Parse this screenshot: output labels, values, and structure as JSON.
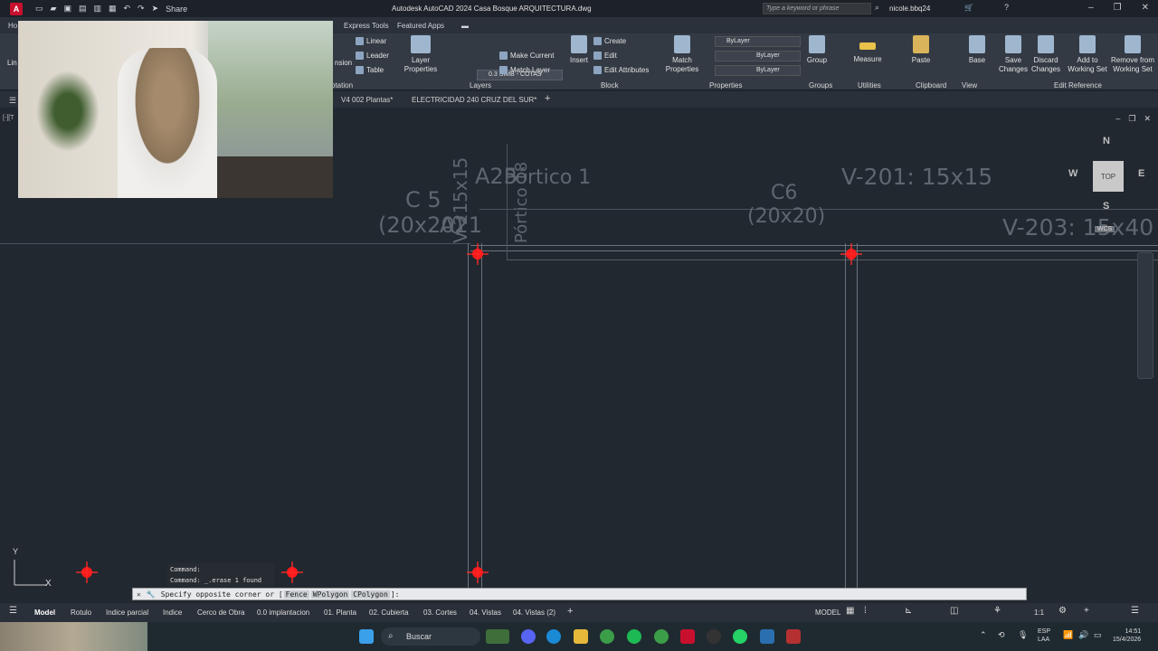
{
  "titlebar": {
    "app_letter": "A",
    "title": "Autodesk AutoCAD 2024    Casa Bosque ARQUITECTURA.dwg",
    "share": "Share",
    "search_placeholder": "Type a keyword or phrase",
    "user": "nicole.bbq24"
  },
  "ribbon_tabs": {
    "home_fragment": "Ho",
    "express_tools": "Express Tools",
    "featured_apps": "Featured Apps"
  },
  "ribbon": {
    "annotation": {
      "linear": "Linear",
      "leader": "Leader",
      "table": "Table",
      "dimension_fragment": "nsion",
      "panel": "otation",
      "line_fragment": "Lin"
    },
    "layers": {
      "layer_properties": "Layer Properties",
      "current_layer": "0.3 SIMB - COTAS",
      "make_current": "Make Current",
      "match_layer": "Match Layer",
      "panel": "Layers"
    },
    "block": {
      "insert": "Insert",
      "create": "Create",
      "edit": "Edit",
      "edit_attributes": "Edit Attributes",
      "panel": "Block"
    },
    "properties": {
      "match_properties": "Match Properties",
      "color": "ByLayer",
      "linetype": "ByLayer",
      "lineweight": "ByLayer",
      "panel": "Properties"
    },
    "groups": {
      "group": "Group",
      "panel": "Groups"
    },
    "utilities": {
      "measure": "Measure",
      "panel": "Utilities"
    },
    "clipboard": {
      "paste": "Paste",
      "panel": "Clipboard"
    },
    "view": {
      "base": "Base",
      "panel": "View"
    },
    "edit_reference": {
      "save": "Save Changes",
      "discard": "Discard Changes",
      "add": "Add to Working Set",
      "remove": "Remove from Working Set",
      "panel": "Edit Reference"
    }
  },
  "doc_tabs": [
    "V4 002 Plantas*",
    "ELECTRICIDAD 240 CRUZ DEL SUR*"
  ],
  "viewport": {
    "label": "[-][T",
    "drawing_texts": {
      "c5": "C 5",
      "c5_size": "(20x20)",
      "c6": "C6",
      "c6_size": "(20x20)",
      "portico1": "Pórtico 1",
      "a25": "A25",
      "v201": "V-201: 15x15",
      "v203": "V-203: 15x40",
      "vert1": "V-215x15",
      "vert2": "Pórtico 18",
      "a21": "A21"
    },
    "viewcube": {
      "top": "TOP",
      "n": "N",
      "s": "S",
      "e": "E",
      "w": "W",
      "wcs": "WCS"
    },
    "ucs": {
      "y": "Y",
      "x": "X"
    }
  },
  "command": {
    "history": [
      "Command:",
      "Command: _.erase 1 found"
    ],
    "prompt": "Specify opposite corner or [",
    "options": [
      "Fence",
      "WPolygon",
      "CPolygon"
    ],
    "prompt_end": "]:"
  },
  "layout_tabs": [
    "Model",
    "Rotulo",
    "Indice parcial",
    "Indice",
    "Cerco de Obra",
    "0.0 implantacion",
    "01. Planta",
    "02. Cubierta",
    "03. Cortes",
    "04. Vistas",
    "04. Vistas (2)"
  ],
  "status": {
    "model": "MODEL",
    "scale": "1:1"
  },
  "taskbar": {
    "search": "Buscar",
    "lang": "ESP",
    "lang2": "LAA",
    "time": "14:51",
    "date": "15/4/2026"
  }
}
